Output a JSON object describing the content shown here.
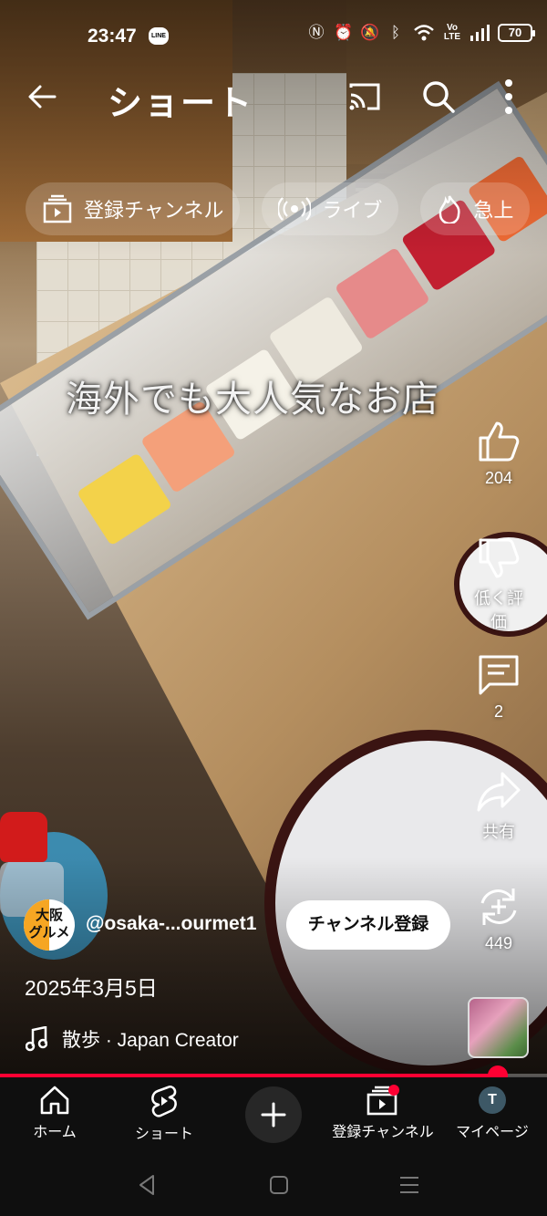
{
  "status_bar": {
    "time": "23:47",
    "line_badge": "LINE",
    "battery": "70",
    "icons": [
      "nfc-icon",
      "alarm-icon",
      "mute-icon",
      "bluetooth-icon",
      "wifi-icon",
      "volte-icon",
      "signal-icon",
      "battery-icon"
    ]
  },
  "header": {
    "title": "ショート"
  },
  "chips": [
    {
      "label": "登録チャンネル",
      "icon": "subscriptions-icon"
    },
    {
      "label": "ライブ",
      "icon": "live-icon"
    },
    {
      "label": "急上",
      "icon": "trending-icon"
    }
  ],
  "video": {
    "caption": "海外でも大人気なお店",
    "channel_avatar_text": "大阪\nグルメ",
    "channel_name": "@osaka-...ourmet1",
    "subscribe_label": "チャンネル登録",
    "date": "2025年3月5日",
    "music": "散歩 · Japan Creator",
    "progress": 0.91
  },
  "actions": {
    "like_count": "204",
    "dislike_label": "低く評価",
    "comment_count": "2",
    "share_label": "共有",
    "remix_count": "449"
  },
  "bottom_nav": {
    "home": "ホーム",
    "shorts": "ショート",
    "subscriptions": "登録チャンネル",
    "you": "マイページ",
    "avatar_letter": "T"
  },
  "colors": {
    "accent": "#ff0033",
    "nav_bg": "#0f0f0f"
  }
}
